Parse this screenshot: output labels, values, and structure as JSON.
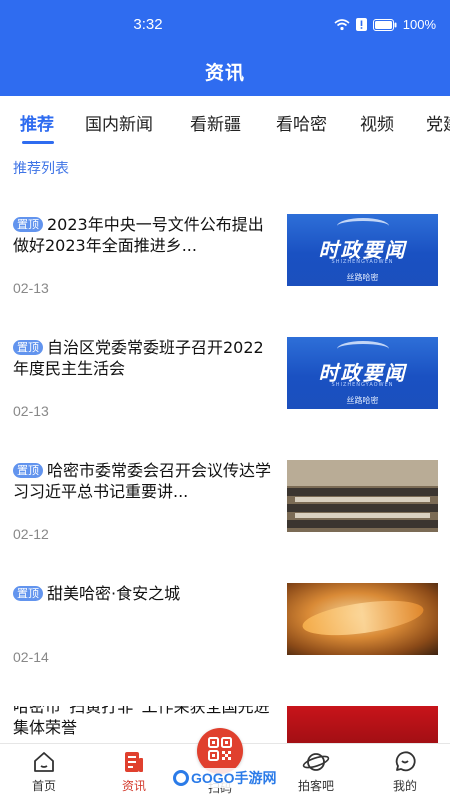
{
  "status_bar": {
    "time": "3:32",
    "battery": "100%"
  },
  "header": {
    "title": "资讯"
  },
  "tabs": [
    {
      "label": "推荐",
      "active": true
    },
    {
      "label": "国内新闻"
    },
    {
      "label": "看新疆"
    },
    {
      "label": "看哈密"
    },
    {
      "label": "视频"
    },
    {
      "label": "党建"
    }
  ],
  "section": {
    "title": "推荐列表"
  },
  "news": [
    {
      "badge": "置顶",
      "title": "2023年中央一号文件公布提出做好2023年全面推进乡...",
      "date": "02-13",
      "thumb": {
        "main": "时政要闻",
        "sub": "SHIZHENGYAOWEN",
        "logo": "丝路哈密"
      }
    },
    {
      "badge": "置顶",
      "title": "自治区党委常委班子召开2022年度民主生活会",
      "date": "02-13",
      "thumb": {
        "main": "时政要闻",
        "sub": "SHIZHENGYAOWEN",
        "logo": "丝路哈密"
      }
    },
    {
      "badge": "置顶",
      "title": "哈密市委常委会召开会议传达学习习近平总书记重要讲...",
      "date": "02-12"
    },
    {
      "badge": "置顶",
      "title": "甜美哈密·食安之城",
      "date": "02-14"
    },
    {
      "badge": "",
      "title": "哈密市“扫黄打非”工作荣获全国先进集体荣誉",
      "date": ""
    }
  ],
  "bottom_nav": [
    {
      "label": "首页",
      "icon": "home-icon"
    },
    {
      "label": "资讯",
      "icon": "news-icon",
      "active": true
    },
    {
      "label": "扫码",
      "icon": "qr-code-icon"
    },
    {
      "label": "拍客吧",
      "icon": "planet-icon"
    },
    {
      "label": "我的",
      "icon": "profile-icon"
    }
  ],
  "watermark": {
    "text": "GOGO手游网"
  },
  "colors": {
    "primary": "#2f6cf0",
    "badge": "#6294ee",
    "accent_red": "#e0402e"
  }
}
